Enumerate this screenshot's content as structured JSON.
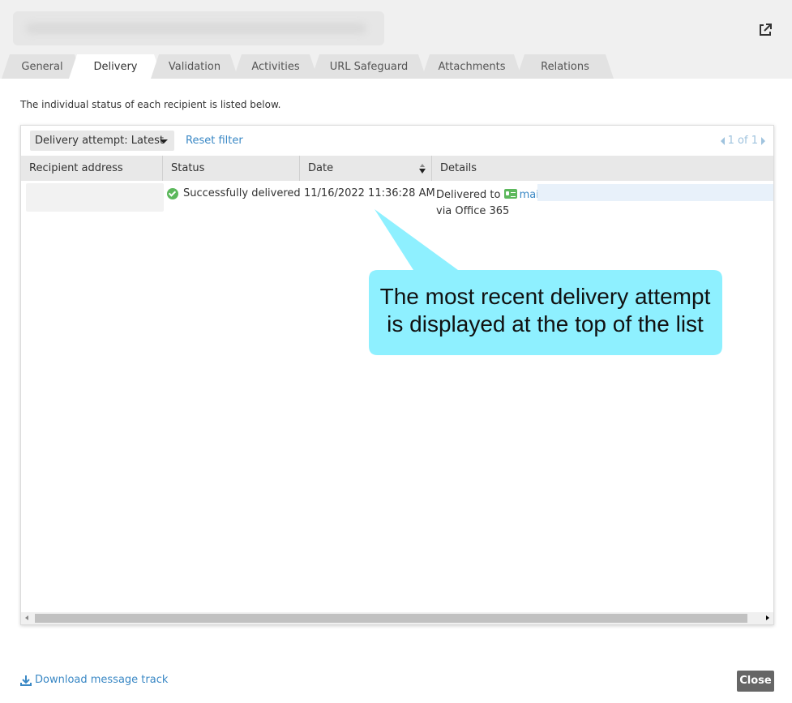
{
  "tabs": [
    {
      "label": "General",
      "active": false
    },
    {
      "label": "Delivery",
      "active": true
    },
    {
      "label": "Validation",
      "active": false
    },
    {
      "label": "Activities",
      "active": false
    },
    {
      "label": "URL Safeguard",
      "active": false
    },
    {
      "label": "Attachments",
      "active": false
    },
    {
      "label": "Relations",
      "active": false
    }
  ],
  "intro_text": "The individual status of each recipient is listed below.",
  "toolbar": {
    "attempt_filter": "Delivery attempt: Latest",
    "reset_filter": "Reset filter",
    "pager": "1 of 1"
  },
  "table": {
    "columns": [
      "Recipient address",
      "Status",
      "Date",
      "Details"
    ],
    "rows": [
      {
        "status": "Successfully delivered",
        "date": "11/16/2022 11:36:28 AM",
        "details_prefix": "Delivered to",
        "details_link": "mail",
        "details_suffix": "via Office 365"
      }
    ]
  },
  "callout": {
    "line1": "The most recent delivery attempt",
    "line2": "is displayed at the top of the list",
    "color": "#8ef0ff"
  },
  "footer": {
    "download_label": "Download message track",
    "close_label": "Close"
  },
  "colors": {
    "link": "#3a88c5",
    "success": "#5cb85c",
    "close_button": "#666666"
  }
}
